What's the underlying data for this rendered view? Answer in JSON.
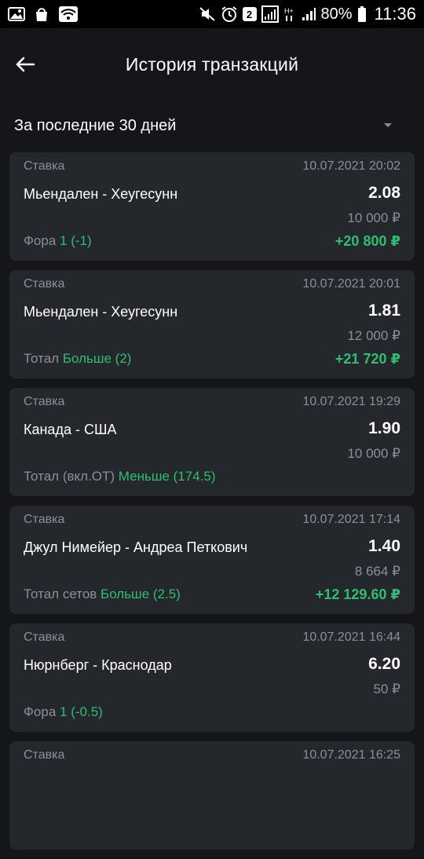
{
  "status_bar": {
    "battery": "80%",
    "time": "11:36",
    "sim_slot": "2"
  },
  "header": {
    "title": "История транзакций"
  },
  "filter": {
    "period": "За последние 30 дней"
  },
  "transactions": [
    {
      "type": "Ставка",
      "datetime": "10.07.2021 20:02",
      "event": "Мьендален - Хеугесунн",
      "coef": "2.08",
      "stake": "10 000 ₽",
      "market": "Фора",
      "outcome": "1 (-1)",
      "win": "+20 800 ₽"
    },
    {
      "type": "Ставка",
      "datetime": "10.07.2021 20:01",
      "event": "Мьендален - Хеугесунн",
      "coef": "1.81",
      "stake": "12 000 ₽",
      "market": "Тотал",
      "outcome": "Больше (2)",
      "win": "+21 720 ₽"
    },
    {
      "type": "Ставка",
      "datetime": "10.07.2021 19:29",
      "event": "Канада - США",
      "coef": "1.90",
      "stake": "10 000 ₽",
      "market": "Тотал (вкл.ОТ)",
      "outcome": "Меньше (174.5)",
      "win": ""
    },
    {
      "type": "Ставка",
      "datetime": "10.07.2021 17:14",
      "event": "Джул Нимейер - Андреа Петкович",
      "coef": "1.40",
      "stake": "8 664 ₽",
      "market": "Тотал сетов",
      "outcome": "Больше (2.5)",
      "win": "+12 129.60 ₽"
    },
    {
      "type": "Ставка",
      "datetime": "10.07.2021 16:44",
      "event": "Нюрнберг - Краснодар",
      "coef": "6.20",
      "stake": "50 ₽",
      "market": "Фора",
      "outcome": "1 (-0.5)",
      "win": ""
    },
    {
      "type": "Ставка",
      "datetime": "10.07.2021 16:25",
      "event": "",
      "coef": "",
      "stake": "",
      "market": "",
      "outcome": "",
      "win": ""
    }
  ],
  "colors": {
    "background": "#141619",
    "card": "#24272c",
    "accent_green": "#2fbf71",
    "muted_text": "#8b9097"
  }
}
